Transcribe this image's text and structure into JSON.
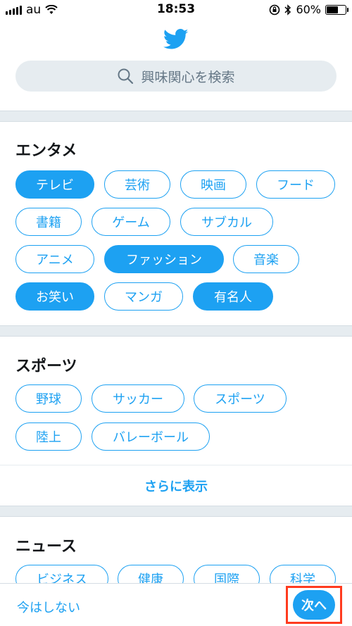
{
  "status_bar": {
    "carrier": "au",
    "time": "18:53",
    "battery_percent": "60%",
    "battery_level": 0.6
  },
  "search": {
    "placeholder": "興味関心を検索"
  },
  "sections": [
    {
      "title": "エンタメ",
      "chips": [
        {
          "label": "テレビ",
          "selected": true
        },
        {
          "label": "芸術",
          "selected": false
        },
        {
          "label": "映画",
          "selected": false
        },
        {
          "label": "フード",
          "selected": false
        },
        {
          "label": "書籍",
          "selected": false
        },
        {
          "label": "ゲーム",
          "selected": false
        },
        {
          "label": "サブカル",
          "selected": false
        },
        {
          "label": "アニメ",
          "selected": false
        },
        {
          "label": "ファッション",
          "selected": true
        },
        {
          "label": "音楽",
          "selected": false
        },
        {
          "label": "お笑い",
          "selected": true
        },
        {
          "label": "マンガ",
          "selected": false
        },
        {
          "label": "有名人",
          "selected": true
        }
      ]
    },
    {
      "title": "スポーツ",
      "chips": [
        {
          "label": "野球",
          "selected": false
        },
        {
          "label": "サッカー",
          "selected": false
        },
        {
          "label": "スポーツ",
          "selected": false
        },
        {
          "label": "陸上",
          "selected": false
        },
        {
          "label": "バレーボール",
          "selected": false
        }
      ],
      "show_more": "さらに表示"
    },
    {
      "title": "ニュース",
      "chips": [
        {
          "label": "ビジネス",
          "selected": false
        },
        {
          "label": "健康",
          "selected": false
        },
        {
          "label": "国際",
          "selected": false
        },
        {
          "label": "科学",
          "selected": false
        }
      ]
    }
  ],
  "footer": {
    "skip_label": "今はしない",
    "next_label": "次へ"
  },
  "colors": {
    "accent": "#1da1f2",
    "highlight": "#ff3b1f",
    "divider": "#e6ecf0"
  }
}
